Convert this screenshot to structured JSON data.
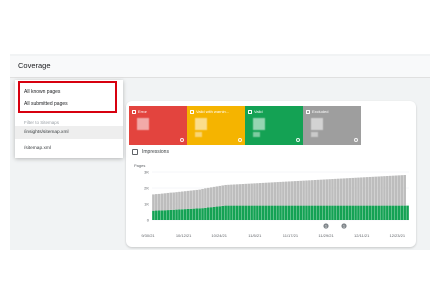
{
  "header": {
    "title": "Coverage"
  },
  "dropdown": {
    "options": [
      "All known pages",
      "All submitted pages"
    ],
    "filter_label": "Filter to Sitemaps",
    "sitemaps": [
      "/insights/sitemap.xml",
      "/sitemap.xml"
    ]
  },
  "tiles": [
    {
      "label": "Error",
      "color": "#e3443e"
    },
    {
      "label": "Valid with warnin...",
      "color": "#f5b400"
    },
    {
      "label": "Valid",
      "color": "#14a254"
    },
    {
      "label": "Excluded",
      "color": "#9e9e9e"
    }
  ],
  "impressions_label": "Impressions",
  "chart_data": {
    "type": "bar",
    "stacked": true,
    "ylabel": "Pages",
    "y_ticks": [
      "3K",
      "2K",
      "1K",
      "0"
    ],
    "ylim": [
      0,
      3000
    ],
    "x_ticks": [
      "9/30/21",
      "10/12/21",
      "10/24/21",
      "11/5/21",
      "11/17/21",
      "11/29/21",
      "12/11/21",
      "12/23/21"
    ],
    "annotations": [
      "1",
      "1"
    ],
    "series": [
      {
        "name": "Valid",
        "color": "#14a254",
        "values": [
          580,
          590,
          600,
          600,
          610,
          620,
          630,
          640,
          650,
          660,
          670,
          680,
          690,
          700,
          710,
          720,
          730,
          740,
          760,
          780,
          800,
          820,
          840,
          860,
          880,
          900,
          900,
          900,
          900,
          900,
          900,
          900,
          900,
          900,
          900,
          900,
          900,
          900,
          900,
          900,
          900,
          900,
          900,
          900,
          900,
          900,
          900,
          900,
          900,
          900,
          900,
          900,
          900,
          900,
          900,
          900,
          900,
          900,
          900,
          900,
          900,
          900,
          900,
          900,
          900,
          900,
          900,
          900,
          900,
          900,
          900,
          900,
          900,
          900,
          900,
          900,
          900,
          900,
          900,
          900,
          900,
          900,
          900,
          900,
          900,
          900,
          900,
          900,
          900
        ]
      },
      {
        "name": "Excluded",
        "color": "#bdbdbd",
        "values": [
          1020,
          1030,
          1030,
          1050,
          1060,
          1070,
          1080,
          1080,
          1090,
          1100,
          1110,
          1120,
          1130,
          1140,
          1150,
          1160,
          1170,
          1200,
          1220,
          1230,
          1240,
          1250,
          1260,
          1270,
          1280,
          1290,
          1300,
          1310,
          1320,
          1330,
          1340,
          1350,
          1360,
          1370,
          1380,
          1390,
          1400,
          1410,
          1420,
          1430,
          1440,
          1450,
          1460,
          1470,
          1480,
          1490,
          1500,
          1510,
          1520,
          1530,
          1540,
          1550,
          1560,
          1570,
          1580,
          1590,
          1600,
          1610,
          1620,
          1630,
          1640,
          1650,
          1660,
          1670,
          1680,
          1690,
          1700,
          1710,
          1720,
          1730,
          1740,
          1750,
          1760,
          1770,
          1780,
          1790,
          1800,
          1810,
          1820,
          1830,
          1840,
          1850,
          1860,
          1870,
          1880,
          1890,
          1900,
          1910
        ]
      }
    ]
  }
}
